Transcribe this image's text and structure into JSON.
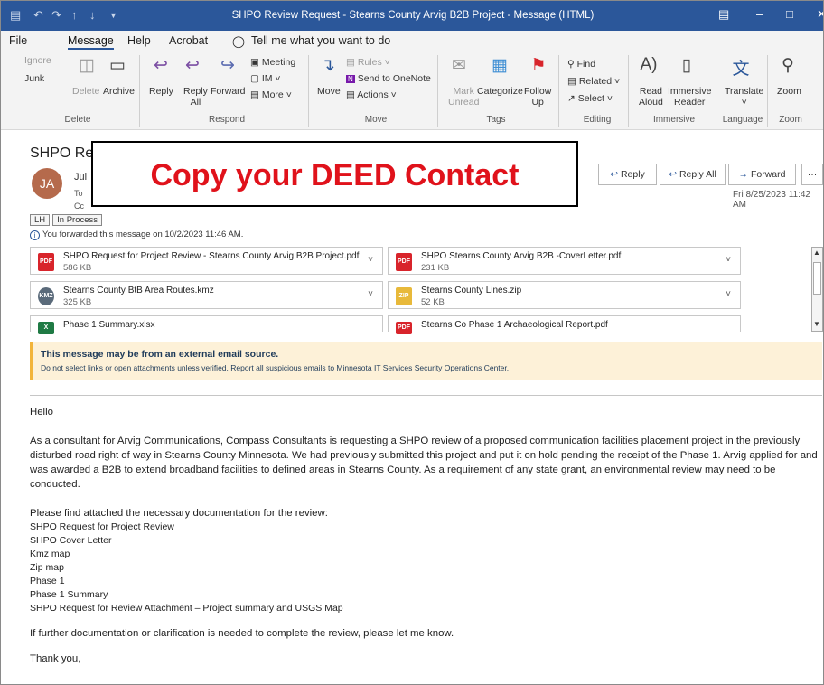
{
  "window": {
    "title": "SHPO Review Request - Stearns County Arvig B2B Project  -  Message (HTML)",
    "accent": "#2b579a"
  },
  "menu": [
    "File",
    "Message",
    "Help",
    "Acrobat",
    "Tell me what you want to do"
  ],
  "ribbon": {
    "delete": {
      "ignore": "Ignore",
      "junk": "Junk",
      "delete": "Delete",
      "archive": "Archive",
      "group": "Delete"
    },
    "respond": {
      "reply": "Reply",
      "reply_all_1": "Reply",
      "reply_all_2": "All",
      "forward": "Forward",
      "meeting": "Meeting",
      "im": "IM",
      "more": "More",
      "group": "Respond"
    },
    "move": {
      "move": "Move",
      "rules": "Rules",
      "onenote": "Send to OneNote",
      "actions": "Actions",
      "group": "Move"
    },
    "tags": {
      "mark_1": "Mark",
      "mark_2": "Unread",
      "categorize": "Categorize",
      "follow_1": "Follow",
      "follow_2": "Up",
      "group": "Tags"
    },
    "editing": {
      "find": "Find",
      "related": "Related",
      "select": "Select",
      "group": "Editing"
    },
    "immersive": {
      "read_1": "Read",
      "read_2": "Aloud",
      "immersive_1": "Immersive",
      "immersive_2": "Reader",
      "group": "Immersive"
    },
    "language": {
      "translate": "Translate",
      "group": "Language"
    },
    "zoom": {
      "zoom": "Zoom",
      "group": "Zoom"
    }
  },
  "message": {
    "subject": "SHPO Re",
    "avatar_initials": "JA",
    "from_fragment": "Jul",
    "to_label": "To",
    "cc_label": "Cc",
    "date": "Fri 8/25/2023 11:42 AM",
    "actions": {
      "reply": "Reply",
      "reply_all": "Reply All",
      "forward": "Forward",
      "more": "···"
    },
    "tags": [
      "LH",
      "In Process"
    ],
    "forwarded_note": "You forwarded this message on 10/2/2023 11:46 AM."
  },
  "overlay_text": "Copy your DEED Contact",
  "attachments": [
    {
      "name": "SHPO Request for Project Review - Stearns County Arvig B2B Project.pdf",
      "size": "586 KB",
      "icon": "pdf-icon",
      "color": "#d8242b"
    },
    {
      "name": "SHPO Stearns County Arvig B2B  -CoverLetter.pdf",
      "size": "231 KB",
      "icon": "pdf-icon",
      "color": "#d8242b"
    },
    {
      "name": "Stearns County BtB Area Routes.kmz",
      "size": "325 KB",
      "icon": "kmz-globe-icon",
      "color": "#5a6a7a"
    },
    {
      "name": "Stearns County Lines.zip",
      "size": "52 KB",
      "icon": "zip-folder-icon",
      "color": "#e8b93a"
    },
    {
      "name": "Phase 1 Summary.xlsx",
      "size": "",
      "icon": "excel-icon",
      "color": "#1f7a44"
    },
    {
      "name": "Stearns Co Phase 1 Archaeological Report.pdf",
      "size": "",
      "icon": "pdf-icon",
      "color": "#d8242b"
    }
  ],
  "warning": {
    "title": "This message may be from an external email source.",
    "body": "Do not select links or open attachments unless verified. Report all suspicious emails to Minnesota IT Services Security Operations Center.",
    "color": "#fdf1d8"
  },
  "body": {
    "greeting": "Hello",
    "para1": "As a consultant for Arvig Communications, Compass Consultants is requesting a SHPO review of a proposed communication facilities placement project in the previously disturbed road right of way in Stearns County Minnesota. We had previously submitted this project and put it on hold pending the receipt of the Phase 1. Arvig applied for and was awarded a B2B to extend broadband facilities to defined areas in Stearns County. As a requirement of any state grant, an environmental review may need to be conducted.",
    "list_intro": "Please find attached the necessary documentation for the review:",
    "list": [
      "SHPO Request for Project Review",
      "SHPO Cover Letter",
      "Kmz map",
      "Zip map",
      "Phase 1",
      "Phase 1 Summary",
      "SHPO Request for Review Attachment – Project summary and USGS Map"
    ],
    "para2": "If further documentation or clarification is needed to complete the review, please let me know.",
    "closing": "Thank you,"
  }
}
